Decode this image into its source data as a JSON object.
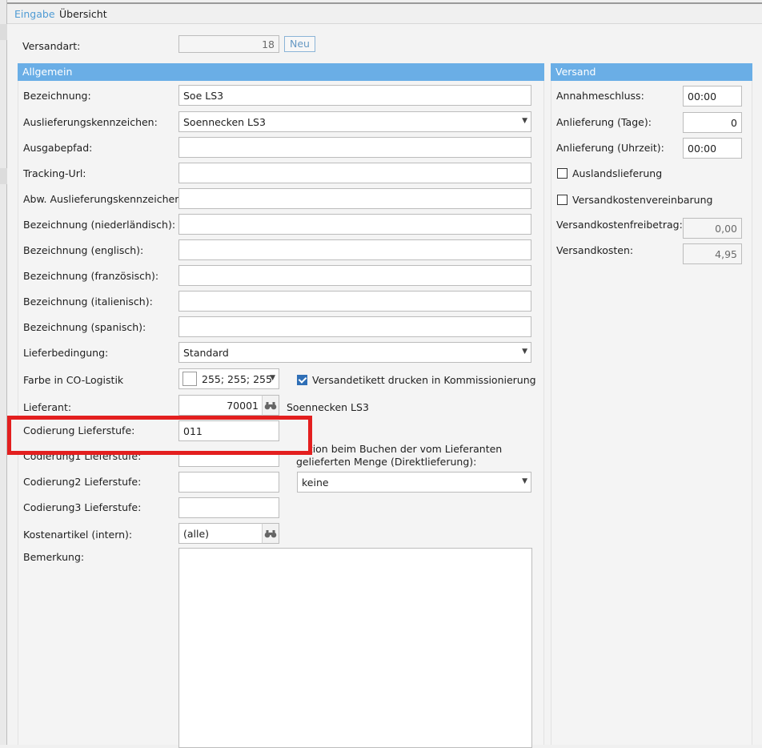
{
  "tabs": [
    {
      "label": "Eingabe",
      "active": true
    },
    {
      "label": "Übersicht",
      "active": false
    }
  ],
  "versandart": {
    "label": "Versandart:",
    "value": "18",
    "new_button": "Neu"
  },
  "allgemein": {
    "title": "Allgemein",
    "bezeichnung": {
      "label": "Bezeichnung:",
      "value": "Soe LS3"
    },
    "auslieferungskennzeichen": {
      "label": "Auslieferungskennzeichen:",
      "value": "Soennecken LS3"
    },
    "ausgabepfad": {
      "label": "Ausgabepfad:",
      "value": ""
    },
    "tracking_url": {
      "label": "Tracking-Url:",
      "value": ""
    },
    "abw_auslieferungskennzeichen": {
      "label": "Abw. Auslieferungskennzeichen:",
      "value": ""
    },
    "bez_nl": {
      "label": "Bezeichnung (niederländisch):",
      "value": ""
    },
    "bez_en": {
      "label": "Bezeichnung (englisch):",
      "value": ""
    },
    "bez_fr": {
      "label": "Bezeichnung (französisch):",
      "value": ""
    },
    "bez_it": {
      "label": "Bezeichnung (italienisch):",
      "value": ""
    },
    "bez_es": {
      "label": "Bezeichnung (spanisch):",
      "value": ""
    },
    "lieferbedingung": {
      "label": "Lieferbedingung:",
      "value": "Standard"
    },
    "farbe": {
      "label": "Farbe in CO-Logistik",
      "value": "255; 255; 255"
    },
    "versandetikett": {
      "label": "Versandetikett drucken in Kommissionierung",
      "checked": true
    },
    "lieferant": {
      "label": "Lieferant:",
      "value": "70001",
      "name": "Soennecken LS3"
    },
    "codierung": {
      "label": "Codierung Lieferstufe:",
      "value": "011"
    },
    "codierung1": {
      "label": "Codierung1 Lieferstufe:",
      "value": ""
    },
    "codierung2": {
      "label": "Codierung2 Lieferstufe:",
      "value": ""
    },
    "codierung3": {
      "label": "Codierung3 Lieferstufe:",
      "value": ""
    },
    "aktion": {
      "label_line1": "Aktion beim Buchen der vom Lieferanten",
      "label_line2": "gelieferten Menge (Direktlieferung):",
      "value": "keine"
    },
    "kostenartikel": {
      "label": "Kostenartikel (intern):",
      "value": "(alle)"
    },
    "bemerkung": {
      "label": "Bemerkung:",
      "value": ""
    }
  },
  "versand": {
    "title": "Versand",
    "annahmeschluss": {
      "label": "Annahmeschluss:",
      "value": "00:00"
    },
    "anlieferung_tage": {
      "label": "Anlieferung (Tage):",
      "value": "0"
    },
    "anlieferung_uhrzeit": {
      "label": "Anlieferung (Uhrzeit):",
      "value": "00:00"
    },
    "auslandslieferung": {
      "label": "Auslandslieferung",
      "checked": false
    },
    "versandkostenvereinbarung": {
      "label": "Versandkostenvereinbarung",
      "checked": false
    },
    "versandkostenfreibetrag": {
      "label": "Versandkostenfreibetrag:",
      "value": "0,00"
    },
    "versandkosten": {
      "label": "Versandkosten:",
      "value": "4,95"
    }
  },
  "colors": {
    "accent": "#6aaee6",
    "highlight": "#e31f1f",
    "checkbox": "#2f6fb6"
  },
  "icons": {
    "lookup": "binoculars-icon",
    "dropdown": "chevron-down-icon",
    "check": "check-icon"
  }
}
